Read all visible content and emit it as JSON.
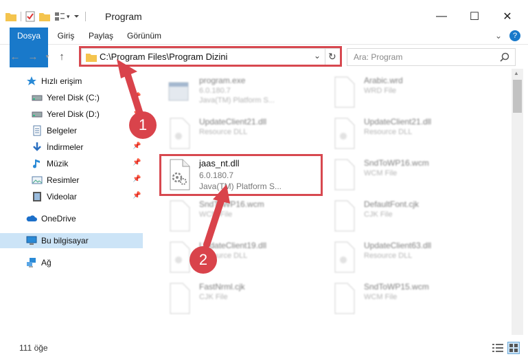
{
  "window": {
    "title": "Program",
    "minimize": "—",
    "maximize": "☐",
    "close": "✕"
  },
  "ribbon": {
    "tabs": [
      "Dosya",
      "Giriş",
      "Paylaş",
      "Görünüm"
    ],
    "expand": "⌄",
    "help": "?"
  },
  "navigation": {
    "address": "C:\\Program Files\\Program Dizini",
    "search_placeholder": "Ara: Program"
  },
  "sidebar": {
    "items": [
      {
        "label": "Hızlı erişim",
        "icon": "star-icon"
      },
      {
        "label": "Yerel Disk (C:)",
        "icon": "drive-icon"
      },
      {
        "label": "Yerel Disk (D:)",
        "icon": "drive-icon"
      },
      {
        "label": "Belgeler",
        "icon": "documents-icon"
      },
      {
        "label": "İndirmeler",
        "icon": "download-icon"
      },
      {
        "label": "Müzik",
        "icon": "music-icon"
      },
      {
        "label": "Resimler",
        "icon": "pictures-icon"
      },
      {
        "label": "Videolar",
        "icon": "videos-icon"
      },
      {
        "label": "OneDrive",
        "icon": "cloud-icon"
      },
      {
        "label": "Bu bilgisayar",
        "icon": "computer-icon"
      },
      {
        "label": "Ağ",
        "icon": "network-icon"
      }
    ]
  },
  "files": [
    {
      "name": "program.exe",
      "line2": "6.0.180.7",
      "line3": "Java(TM) Platform S..."
    },
    {
      "name": "Arabic.wrd",
      "line2": "WRD File",
      "line3": ""
    },
    {
      "name": "UpdateClient21.dll",
      "line2": "Resource DLL",
      "line3": ""
    },
    {
      "name": "UpdateClient21.dll",
      "line2": "Resource DLL",
      "line3": ""
    },
    {
      "name": "jaas_nt.dll",
      "line2": "6.0.180.7",
      "line3": "Java(TM) Platform S..."
    },
    {
      "name": "SndToWP16.wcm",
      "line2": "WCM File",
      "line3": ""
    },
    {
      "name": "SndToWP16.wcm",
      "line2": "WCM File",
      "line3": ""
    },
    {
      "name": "DefaultFont.cjk",
      "line2": "CJK File",
      "line3": ""
    },
    {
      "name": "UpdateClient19.dll",
      "line2": "Resource DLL",
      "line3": ""
    },
    {
      "name": "UpdateClient63.dll",
      "line2": "Resource DLL",
      "line3": ""
    },
    {
      "name": "FastNrml.cjk",
      "line2": "CJK File",
      "line3": ""
    },
    {
      "name": "SndToWP15.wcm",
      "line2": "WCM File",
      "line3": ""
    }
  ],
  "status": {
    "count": "111 öğe"
  },
  "annotations": {
    "step1": "1",
    "step2": "2"
  },
  "colors": {
    "accent": "#1979ca",
    "annotation_red": "#d7484f",
    "selection": "#cce4f7"
  }
}
